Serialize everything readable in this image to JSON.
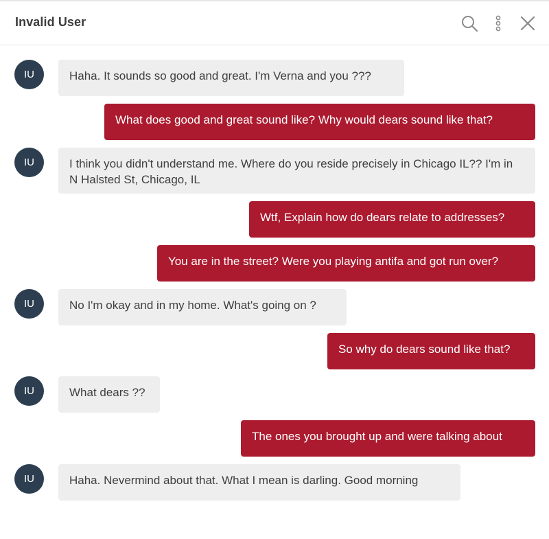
{
  "header": {
    "title": "Invalid User",
    "search_icon": "search-icon",
    "more_icon": "more-vertical-icon",
    "close_icon": "close-icon"
  },
  "avatar_initials": "IU",
  "colors": {
    "outgoing_bubble": "#ac1a2f",
    "incoming_bubble": "#eeeeee",
    "avatar": "#2c3e50"
  },
  "messages": [
    {
      "direction": "incoming",
      "text": "Haha. It sounds so good and great. I'm Verna and you ???"
    },
    {
      "direction": "outgoing",
      "text": "What does good and great sound like? Why would dears sound like that?"
    },
    {
      "direction": "incoming",
      "text": "I think you didn't understand me. Where do you reside precisely in Chicago IL?? I'm in N Halsted St, Chicago, IL"
    },
    {
      "direction": "outgoing",
      "text": "Wtf, Explain how do dears relate to addresses?"
    },
    {
      "direction": "outgoing",
      "text": "You are in the street? Were you playing antifa and got run over?"
    },
    {
      "direction": "incoming",
      "text": "No I'm okay and in my home. What's going on ?"
    },
    {
      "direction": "outgoing",
      "text": "So why do dears sound like that?"
    },
    {
      "direction": "incoming",
      "text": "What dears ??"
    },
    {
      "direction": "outgoing",
      "text": "The ones you brought up and were talking about"
    },
    {
      "direction": "incoming",
      "text": "Haha. Nevermind about that. What I mean is darling. Good morning"
    }
  ]
}
